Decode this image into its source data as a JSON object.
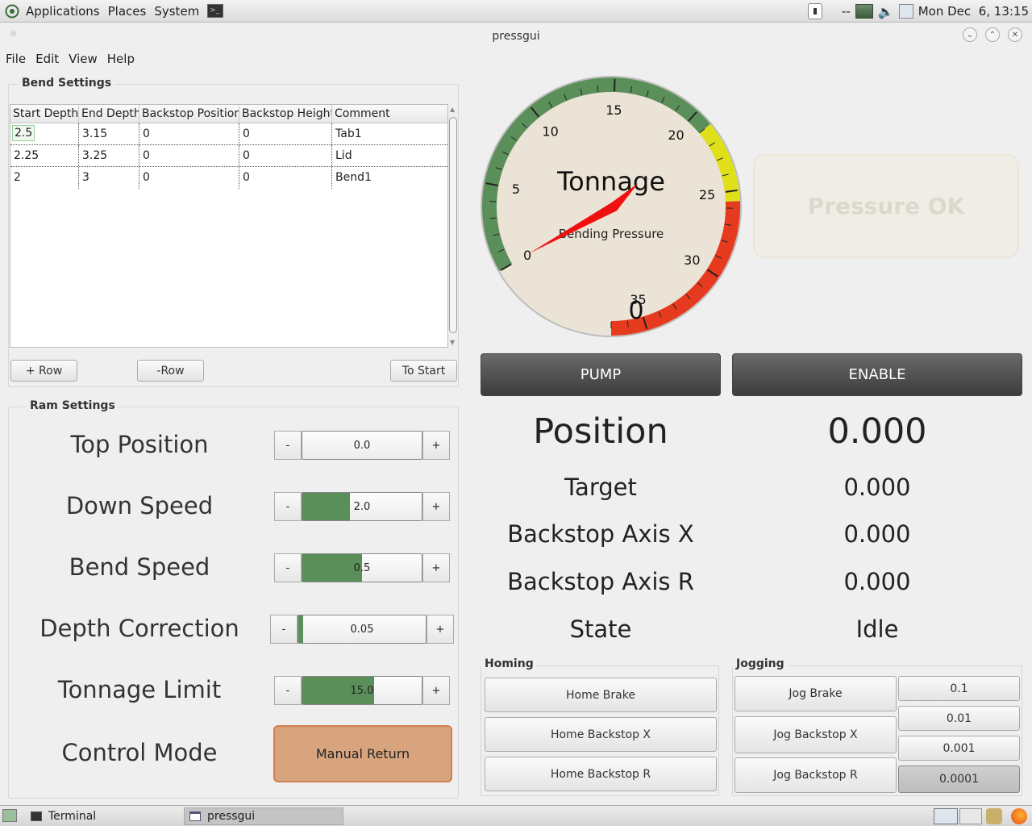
{
  "panel": {
    "menus": [
      "Applications",
      "Places",
      "System"
    ],
    "tray_status": "--",
    "clock": "Mon Dec  6, 13:15"
  },
  "window": {
    "title": "pressgui",
    "menubar": [
      "File",
      "Edit",
      "View",
      "Help"
    ]
  },
  "bend_settings": {
    "title": "Bend Settings",
    "columns": [
      "Start Depth",
      "End Depth",
      "Backstop Position",
      "Backstop Height",
      "Comment"
    ],
    "rows": [
      [
        "2.5",
        "3.15",
        "0",
        "0",
        "Tab1"
      ],
      [
        "2.25",
        "3.25",
        "0",
        "0",
        "Lid"
      ],
      [
        "2",
        "3",
        "0",
        "0",
        "Bend1"
      ]
    ],
    "add_row_label": "+ Row",
    "remove_row_label": "-Row",
    "to_start_label": "To Start"
  },
  "ram_settings": {
    "title": "Ram Settings",
    "minus": "-",
    "plus": "+",
    "items": [
      {
        "label": "Top Position",
        "value": "0.0",
        "fraction": 0.0
      },
      {
        "label": "Down Speed",
        "value": "2.0",
        "fraction": 0.4
      },
      {
        "label": "Bend Speed",
        "value": "0.5",
        "fraction": 0.5
      },
      {
        "label": "Depth Correction",
        "value": "0.05",
        "fraction": 0.04
      },
      {
        "label": "Tonnage Limit",
        "value": "15.0",
        "fraction": 0.6
      }
    ],
    "control_mode_label": "Control Mode",
    "control_mode_value": "Manual Return"
  },
  "gauge": {
    "title": "Tonnage",
    "subtitle": "Bending Pressure",
    "value": "0",
    "ticks": [
      "0",
      "5",
      "10",
      "15",
      "20",
      "25",
      "30",
      "35"
    ],
    "needle_value": 0,
    "green": "#5a8f5a",
    "yellow": "#dfe01a",
    "red": "#e63a1e"
  },
  "pressure_ok": "Pressure OK",
  "pump_label": "PUMP",
  "enable_label": "ENABLE",
  "readouts": {
    "position_label": "Position",
    "position_value": "0.000",
    "target_label": "Target",
    "target_value": "0.000",
    "backstop_x_label": "Backstop Axis X",
    "backstop_x_value": "0.000",
    "backstop_r_label": "Backstop Axis R",
    "backstop_r_value": "0.000",
    "state_label": "State",
    "state_value": "Idle"
  },
  "homing": {
    "title": "Homing",
    "buttons": [
      "Home Brake",
      "Home Backstop X",
      "Home Backstop R"
    ]
  },
  "jogging": {
    "title": "Jogging",
    "buttons": [
      "Jog Brake",
      "Jog Backstop X",
      "Jog Backstop R"
    ],
    "increments": [
      "0.1",
      "0.01",
      "0.001",
      "0.0001"
    ],
    "selected_increment": "0.0001"
  },
  "taskbar": {
    "items": [
      "Terminal",
      "pressgui"
    ]
  }
}
